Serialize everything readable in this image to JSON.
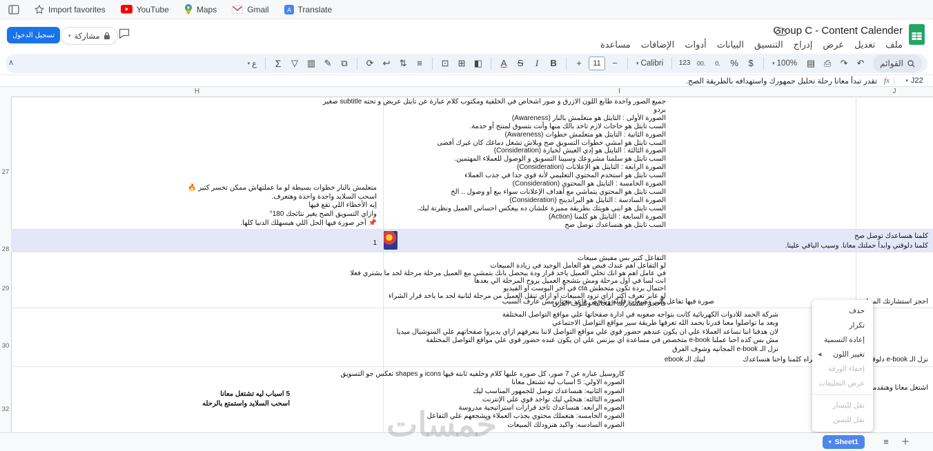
{
  "colors": {
    "accent": "#1a73e8",
    "sheets_green": "#23a566",
    "row_highlight": "#e4e7f8",
    "tab_blue": "#4f86ec"
  },
  "browser": {
    "bookmarks": [
      {
        "label": "Import favorites"
      },
      {
        "label": "YouTube"
      },
      {
        "label": "Maps"
      },
      {
        "label": "Gmail"
      },
      {
        "label": "Translate"
      }
    ]
  },
  "header": {
    "title": "Group C - Content Calender",
    "signin_label": "تسجيل الدخول",
    "share_label": "مشاركة",
    "menus": [
      "ملف",
      "تعديل",
      "عرض",
      "إدراج",
      "التنسيق",
      "البيانات",
      "أدوات",
      "الإضافات",
      "مساعدة"
    ]
  },
  "toolbar": {
    "search_label": "القوائم",
    "zoom": "100%",
    "font": "Calibri",
    "font_size": "11",
    "minus": "−",
    "plus": "+",
    "text_direction_label": "ع",
    "icons_a": [
      {
        "name": "undo-icon",
        "glyph": "↶"
      },
      {
        "name": "redo-icon",
        "glyph": "↷"
      },
      {
        "name": "print-icon",
        "glyph": "⎙"
      },
      {
        "name": "paint-format-icon",
        "glyph": "▤"
      }
    ],
    "icons_num": [
      {
        "name": "currency-icon",
        "glyph": "$"
      },
      {
        "name": "percent-icon",
        "glyph": "%"
      },
      {
        "name": "decrease-decimal-icon",
        "glyph": ".0"
      },
      {
        "name": "increase-decimal-icon",
        "glyph": ".00"
      },
      {
        "name": "number-format-icon",
        "glyph": "123"
      }
    ],
    "icons_style": [
      {
        "name": "bold-icon",
        "glyph": "B"
      },
      {
        "name": "italic-icon",
        "glyph": "I"
      },
      {
        "name": "strikethrough-icon",
        "glyph": "S"
      },
      {
        "name": "text-color-icon",
        "glyph": "A"
      }
    ],
    "icons_cell": [
      {
        "name": "fill-color-icon",
        "glyph": "◧"
      },
      {
        "name": "borders-icon",
        "glyph": "⊞"
      },
      {
        "name": "merge-cells-icon",
        "glyph": "⊡"
      }
    ],
    "icons_align": [
      {
        "name": "horizontal-align-icon",
        "glyph": "≡"
      },
      {
        "name": "vertical-align-icon",
        "glyph": "⇅"
      },
      {
        "name": "text-wrap-icon",
        "glyph": "↩"
      },
      {
        "name": "text-rotation-icon",
        "glyph": "⟳"
      }
    ],
    "icons_insert": [
      {
        "name": "insert-link-icon",
        "glyph": "⧉"
      },
      {
        "name": "insert-comment-icon",
        "glyph": "✎"
      },
      {
        "name": "insert-chart-icon",
        "glyph": "▥"
      },
      {
        "name": "filter-icon",
        "glyph": "▽"
      },
      {
        "name": "functions-icon",
        "glyph": "Σ"
      }
    ]
  },
  "formula_bar": {
    "cell_ref": "J22",
    "fx": "fx",
    "value": "تقدر تبدأ معانا رحلة تحليل جمهورك واستهدافه بالطريقة الصح."
  },
  "grid": {
    "col_headers": [
      "H",
      "I",
      "J"
    ],
    "row_headers": [
      "27",
      "28",
      "29",
      "30",
      "32"
    ],
    "r27_i": [
      "جميع الصور واحدة طابع اللون الازرق و صور اشخاص في الخلفية ومكتوب كلام عبارة عن تايتل عريض و تحته subtitle صغير",
      "بردو",
      "الصورة الأولى : التايتل هو متعلمش بالنار (Awareness)",
      "السب تايتل هو حاجات لازم تاخد بالك منها وأنت بتسوق لمنتج أو خدمة.",
      "الصورة الثانية : التايتل هو متعلمش خطوات (Awareness)",
      "السب تايتل هو امشي خطوات التسويق صح وبلاش تشغل دماغك كان غيرك أفضى",
      "الصورة الثالثة : التايتل هو إدي العيش لخبازة (Consideration)",
      "السب تايتل هو سلمنا مشروعك وسيبنا التسويق و الوصول للعملاء المهتمين.",
      "الصورة الرابعة : التايتل هو الإعلانات (Consideration)",
      "السب تايتل هو استخدم المحتوي التعليمي لأنة قوي جدا في جذب العملاء",
      "الصورة الخامسة : التايتل هو المحتوي (Consideration)",
      "السب تايتل هو المحتوي يتماشي مع أهداف الإعلانات سواء بيع أو وصول .. الخ",
      "الصورة السادسة : التايتل هو البراندينج (Consideration)",
      "السب تايتل هو ابني هويتك بطريقة مميزة علشان ده بيعكس احساس العميل ونظرتة ليك.",
      "الصورة السابعة : التايتل هو كلمنا (Action)",
      "السب تايتل هو هنساعدك توصل صح"
    ],
    "r27_h": [
      "متعلمش بالنار خطوات بسيطة لو ما عملتهاش ممكن تخسر كتير 🔥",
      "اسحب السلايد واحدة واحدة وهتعرف.",
      "إيه الأخطاء اللي تقع فيها",
      "وازاي التسويق الصح يغير نتائجك 180°",
      "📌 آخر صورة فيها الحل اللي هيسهلك الدنيا كلها."
    ],
    "r28_h": "1",
    "r28_j": [
      "كلمنا هنساعدك توصل صح",
      "كلمنا دلوقتي وابدأ حملتك معانا. وسيب الباقي علينا."
    ],
    "r29_i": [
      "التفاعل كتير بس مفيش مبيعات",
      "لو التفاعل اهم عندك فبص هو العامل الوحيد في زيادة المبيعات",
      "في عامل اهم هو انك تخلي العميل ياخد قرار ودة بيحصل بانك بتمشي مع العميل مرحلة مرحلة لحد ما يشتري فعلا",
      "انت لسا في اول مرحلة ومش بتشجع العميل يروح المرحلة الي بعدها",
      "احتمال بردة تكون متحطش cta في آخر البوست او الفيديو",
      "لو عايز تعرف اكتر ازاي تزود المبيعات او ازاي تنقل العميل من مرحلة لتانية لحد ما ياخد قرار الشراء",
      "فاحجز استشارتك المجانية وشوف الفرق"
    ],
    "r29_i2": "صورة فيها تفاعل كتير ومبيعات قليله وشخص قاعد محتار مش عارف السبب",
    "r29_j": "احجز استشارتك المجانية",
    "r30_i": [
      "شركة الحمد للادوات الكهربائية كانت بتواجه صعوبه في ادارة صفحاتها علي مواقع التواصل المختلفة",
      "وبعد ما تواصلوا معنا قدرنا بحمد الله تعرفها طريقة سير مواقع التواصل الاجتماعي",
      "لان هدفنا اننا نساعد العملاء علي ان يكون عندهم حضور قوي علي مواقع التواصل لاننا بنعرفهم ازاي يديروا صفحاتهم علي السوشيال ميديا",
      "مش بس كده احنا عملنا e-book متخصص في مساعدة اي بيزنس علي ان يكون عنده حضور قوي علي مواقع التواصل المختلفة",
      "نزل الـ e-book المجانيه وشوف الفرق"
    ],
    "r30_i2": "لينك الـ ebook",
    "r30_j": "نزل الـ e-book دلوقتي ولو مش بتحب القراه كلمنا واحنا هنساعدك",
    "r32_i": [
      "كاروسيل عباره عن 7 صور، كل صوره عليها كلام وخلفيه ثابته فيها icons و shapes تعكس جو التسويق",
      "الصوره الاولي: 5 اسباب ليه تشتغل معانا",
      "الصوره الثانيه: هنساعدك توصل للجمهور المناسب ليك",
      "الصوره الثالثه: هنخلي ليك تواجد قوي علي الإنترنت",
      "الصوره الرابعه: هنساعدك تاخد قرارات استراتيجية مدروسة",
      "الصوره الخامسه: هنعملك محتوي يجذب العملاء ويشجعهم علي التفاعل",
      "الصوره السادسه: واكيد هنزودلك المبيعات"
    ],
    "r32_h": [
      "5 اسباب ليه تشتغل معانا",
      "اسحب السلايد واستمتع بالرحله"
    ],
    "r32_j": "اشتغل معانا وهنقدملك خدمة متكاملة"
  },
  "context_menu": {
    "items": [
      {
        "name": "delete-menu-item",
        "label": "حذف",
        "enabled": true
      },
      {
        "name": "duplicate-menu-item",
        "label": "تكرار",
        "enabled": true
      },
      {
        "name": "rename-menu-item",
        "label": "إعادة التسمية",
        "enabled": true
      },
      {
        "name": "change-color-menu-item",
        "label": "تغيير اللون",
        "enabled": true,
        "submenu": true
      },
      {
        "name": "hide-sheet-menu-item",
        "label": "إخفاء الورقة",
        "enabled": false
      },
      {
        "name": "show-comments-menu-item",
        "label": "عرض التعليقات",
        "enabled": false
      },
      {
        "name": "menu-separator",
        "label": "",
        "separator": true
      },
      {
        "name": "move-left-menu-item",
        "label": "نقل لليسار",
        "enabled": false
      },
      {
        "name": "move-right-menu-item",
        "label": "نقل لليمين",
        "enabled": false
      }
    ]
  },
  "sheet_bar": {
    "active_tab": "Sheet1"
  },
  "watermark": "خمسات"
}
